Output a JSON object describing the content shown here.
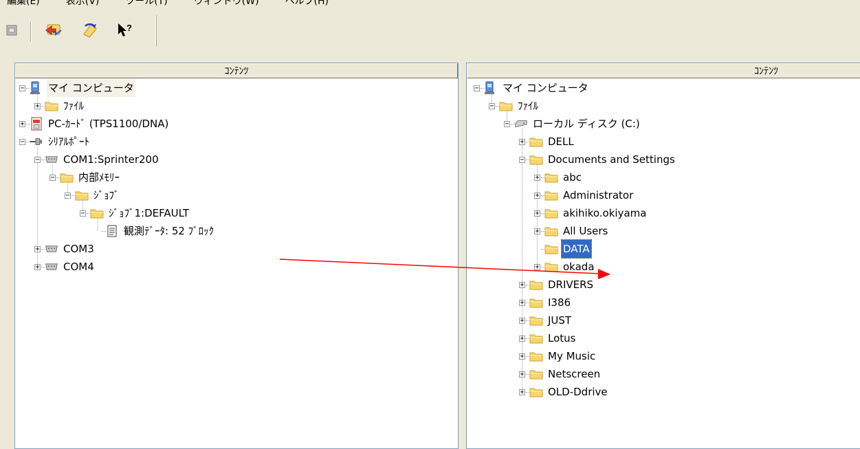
{
  "menu": [
    "編集(E)",
    "表示(V)",
    "ツール(T)",
    "ウィンドウ(W)",
    "ヘルプ(H)"
  ],
  "toolbar": {
    "buttons": [
      {
        "name": "disconnect-icon"
      },
      {
        "name": "transfer-icon"
      },
      {
        "name": "convert-icon"
      },
      {
        "name": "context-help-icon",
        "text": "?"
      }
    ]
  },
  "left_pane": {
    "header": "ｺﾝﾃﾝﾂ",
    "nodes": [
      {
        "label": "マイ コンピュータ",
        "icon": "computer-icon",
        "expander": "−",
        "level": 0
      },
      {
        "label": "ﾌｧｲﾙ",
        "icon": "folder-icon",
        "expander": "+",
        "level": 1
      },
      {
        "label": "PC-ｶｰﾄﾞ (TPS1100/DNA)",
        "icon": "pc-card-icon",
        "expander": "+",
        "level": 0
      },
      {
        "label": "ｼﾘｱﾙﾎﾟｰﾄ",
        "icon": "serial-port-icon",
        "expander": "−",
        "level": 0
      },
      {
        "label": "COM1:Sprinter200",
        "icon": "com-port-icon",
        "expander": "−",
        "level": 1
      },
      {
        "label": "内部ﾒﾓﾘｰ",
        "icon": "folder-icon",
        "expander": "−",
        "level": 2
      },
      {
        "label": "ｼﾞｮﾌﾞ",
        "icon": "folder-icon",
        "expander": "−",
        "level": 3
      },
      {
        "label": "ｼﾞｮﾌﾞ1:DEFAULT",
        "icon": "folder-icon",
        "expander": "−",
        "level": 4
      },
      {
        "label": "観測ﾃﾞｰﾀ: 52 ﾌﾞﾛｯｸ",
        "icon": "document-icon",
        "expander": "",
        "level": 5
      },
      {
        "label": "COM3",
        "icon": "com-port-icon",
        "expander": "+",
        "level": 1
      },
      {
        "label": "COM4",
        "icon": "com-port-icon",
        "expander": "+",
        "level": 1
      }
    ]
  },
  "right_pane": {
    "header": "ｺﾝﾃﾝﾂ",
    "nodes": [
      {
        "label": "マイ コンピュータ",
        "icon": "computer-icon",
        "expander": "−",
        "level": 0
      },
      {
        "label": "ﾌｧｲﾙ",
        "icon": "folder-icon",
        "expander": "−",
        "level": 1
      },
      {
        "label": "ローカル ディスク (C:)",
        "icon": "disk-drive-icon",
        "expander": "−",
        "level": 2
      },
      {
        "label": "DELL",
        "icon": "folder-icon",
        "expander": "+",
        "level": 3
      },
      {
        "label": "Documents and Settings",
        "icon": "folder-icon",
        "expander": "−",
        "level": 3
      },
      {
        "label": "abc",
        "icon": "folder-icon",
        "expander": "+",
        "level": 4
      },
      {
        "label": "Administrator",
        "icon": "folder-icon",
        "expander": "+",
        "level": 4
      },
      {
        "label": "akihiko.okiyama",
        "icon": "folder-icon",
        "expander": "+",
        "level": 4
      },
      {
        "label": "All Users",
        "icon": "folder-icon",
        "expander": "+",
        "level": 4
      },
      {
        "label": "DATA",
        "icon": "folder-icon",
        "expander": "",
        "level": 4,
        "selected": true
      },
      {
        "label": "okada",
        "icon": "folder-icon",
        "expander": "+",
        "level": 4
      },
      {
        "label": "DRIVERS",
        "icon": "folder-icon",
        "expander": "+",
        "level": 3
      },
      {
        "label": "I386",
        "icon": "folder-icon",
        "expander": "+",
        "level": 3
      },
      {
        "label": "JUST",
        "icon": "folder-icon",
        "expander": "+",
        "level": 3
      },
      {
        "label": "Lotus",
        "icon": "folder-icon",
        "expander": "+",
        "level": 3
      },
      {
        "label": "My Music",
        "icon": "folder-icon",
        "expander": "+",
        "level": 3
      },
      {
        "label": "Netscreen",
        "icon": "folder-icon",
        "expander": "+",
        "level": 3
      },
      {
        "label": "OLD-Ddrive",
        "icon": "folder-icon",
        "expander": "+",
        "level": 3
      }
    ]
  },
  "colors": {
    "selection": "#316ac5",
    "arrow": "#ff0000",
    "folder": "#f7d66b"
  }
}
